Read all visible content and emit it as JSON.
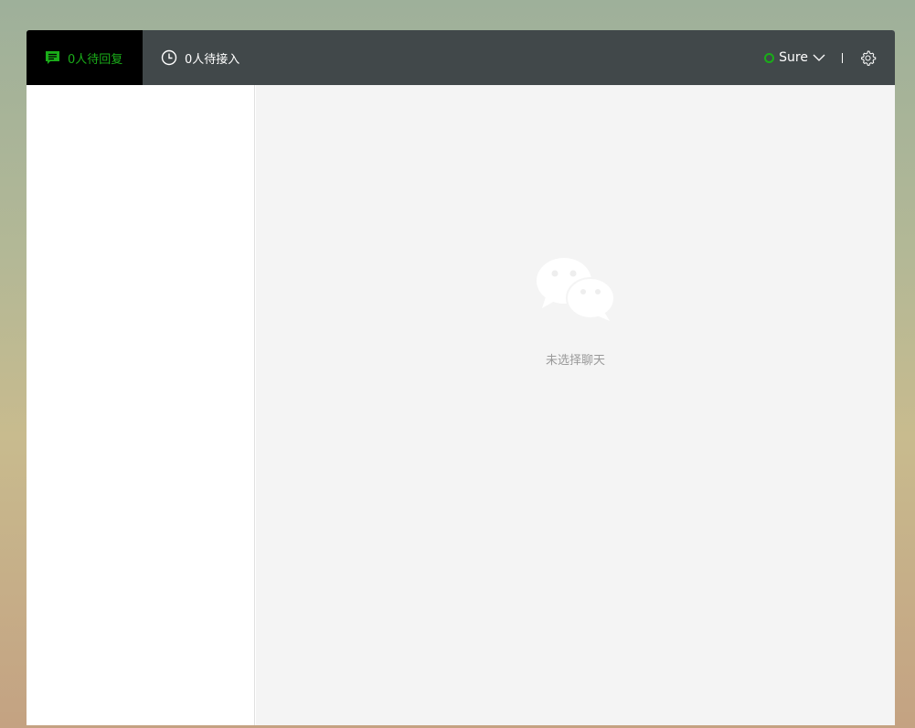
{
  "header": {
    "tabs": [
      {
        "label": "0人待回复",
        "icon": "chat-icon"
      },
      {
        "label": "0人待接入",
        "icon": "clock-icon"
      }
    ],
    "status_name": "Sure",
    "accent": "#1aad19"
  },
  "main": {
    "empty_text": "未选择聊天",
    "icon": "wechat-icon"
  }
}
